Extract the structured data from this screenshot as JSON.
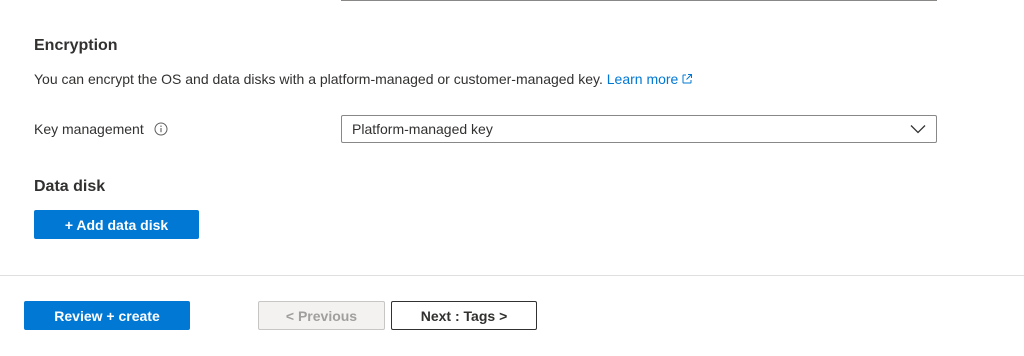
{
  "encryption": {
    "heading": "Encryption",
    "description": "You can encrypt the OS and data disks with a platform-managed or customer-managed key.",
    "learn_more": "Learn more",
    "key_management_label": "Key management",
    "key_management_value": "Platform-managed key"
  },
  "data_disk": {
    "heading": "Data disk",
    "add_button": "+ Add data disk"
  },
  "footer": {
    "review_create": "Review + create",
    "previous": "< Previous",
    "next": "Next : Tags >"
  },
  "colors": {
    "accent": "#0078d4",
    "text": "#323130",
    "disabled_text": "#a19f9d"
  },
  "icons": [
    "info-icon",
    "external-link-icon",
    "chevron-down-icon"
  ]
}
